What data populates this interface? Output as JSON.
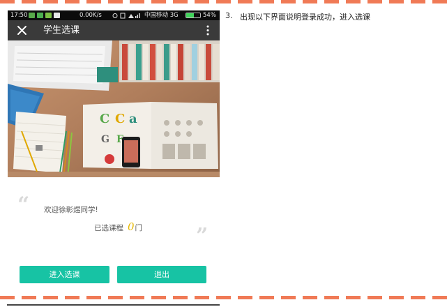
{
  "status_bar": {
    "time": "17:50",
    "speed": "0.00K/s",
    "carrier": "中国移动 3G",
    "battery": "54%",
    "battery_level": 0.54
  },
  "app_bar": {
    "title": "学生选课"
  },
  "welcome": {
    "greeting": "欢迎徐彰煜同学!",
    "selected_prefix": "已选课程",
    "selected_count": "0",
    "selected_suffix": "门",
    "open_quote": "“",
    "close_quote": "”"
  },
  "buttons": {
    "enter": "进入选课",
    "exit": "退出"
  },
  "instruction": {
    "number": "3.",
    "text": "出现以下界面说明登录成功，进入选课"
  },
  "colors": {
    "accent": "#17c3a4",
    "app_bar": "#3a3a3a",
    "dash": "#f07a56",
    "count": "#e6b800"
  }
}
